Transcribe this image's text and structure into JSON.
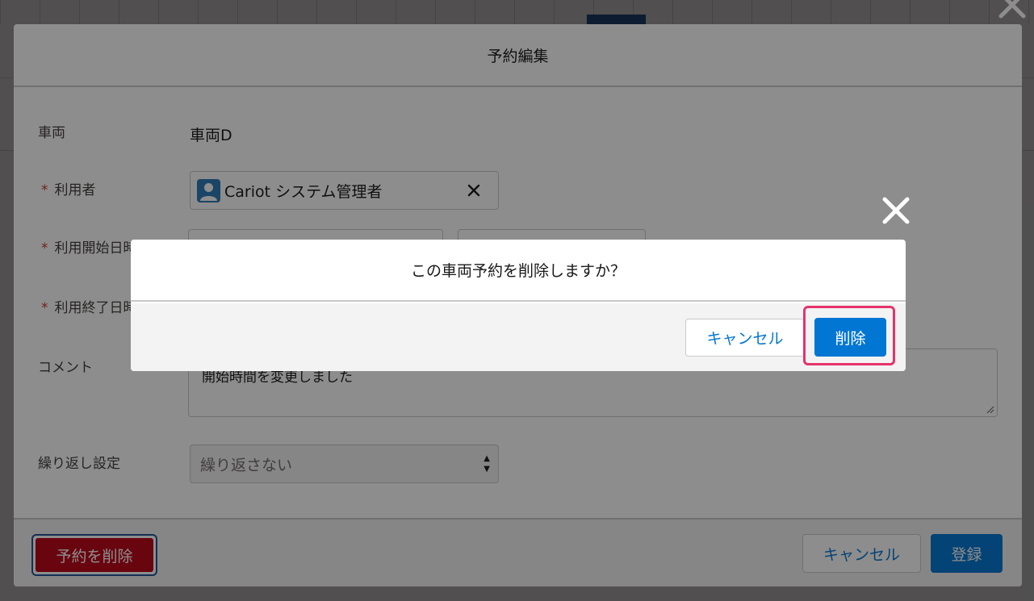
{
  "modal": {
    "title": "予約編集",
    "fields": {
      "vehicle_label": "車両",
      "vehicle_value": "車両D",
      "user_label": "利用者",
      "user_value": "Cariot システム管理者",
      "start_label": "利用開始日時",
      "end_label": "利用終了日時",
      "comment_label": "コメント",
      "comment_value": "開始時間を変更しました",
      "repeat_label": "繰り返し設定",
      "repeat_value": "繰り返さない"
    },
    "required_marker": "*",
    "footer": {
      "delete_label": "予約を削除",
      "cancel_label": "キャンセル",
      "register_label": "登録"
    }
  },
  "dialog": {
    "message": "この車両予約を削除しますか？",
    "cancel_label": "キャンセル",
    "delete_label": "削除"
  },
  "colors": {
    "brand_blue": "#0176d3",
    "destructive_red": "#ba0517",
    "highlight_pink": "#e6336b",
    "avatar_blue": "#2a7ab7"
  },
  "icons": [
    "close-icon",
    "user-avatar-icon",
    "clear-icon",
    "resize-grip-icon",
    "select-arrows-icon"
  ]
}
